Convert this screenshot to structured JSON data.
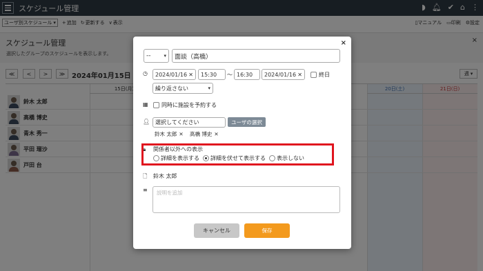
{
  "app": {
    "title": "スケジュール管理",
    "menu_icon": "hamburger-icon",
    "icons": [
      "bookmark-icon",
      "bell-icon",
      "check-icon",
      "home-icon",
      "more-vertical-icon"
    ]
  },
  "toolbar": {
    "view_select": "ユーザ別スケジュール",
    "add_label": "追加",
    "refresh_label": "更新する",
    "display_label": "表示",
    "manual_label": "マニュアル",
    "print_label": "印刷",
    "settings_label": "設定"
  },
  "page": {
    "title": "スケジュール管理",
    "description": "選択したグループのスケジュールを表示します。",
    "close": "×"
  },
  "nav": {
    "first": "≪",
    "prev": "<",
    "next": ">",
    "last": "≫",
    "date": "2024年01月15日",
    "view": "週"
  },
  "calendar": {
    "days": [
      "15日(月)",
      "20日(土)",
      "21日(日)"
    ],
    "users": [
      "鈴木 太郎",
      "高橋 博史",
      "青木 秀一",
      "平田 瑠沙",
      "戸田 台"
    ]
  },
  "modal": {
    "close": "×",
    "category": "--",
    "title_value": "面談（高橋）",
    "start_date": "2024/01/16",
    "start_time": "15:30",
    "tilde": "～",
    "end_time": "16:30",
    "end_date": "2024/01/16",
    "all_day": "終日",
    "repeat": "繰り返さない",
    "facility_check": "同時に施設を予約する",
    "user_placeholder": "選択してください",
    "user_select_button": "ユーザの選択",
    "selected_users": [
      "鈴木 太郎",
      "高橋 博史"
    ],
    "visibility_label": "関係者以外への表示",
    "visibility_options": [
      "詳細を表示する",
      "詳細を伏せて表示する",
      "表示しない"
    ],
    "visibility_selected": 1,
    "owner": "鈴木 太郎",
    "description_placeholder": "説明を追加",
    "cancel": "キャンセル",
    "save": "保存"
  },
  "colors": {
    "appbar": "#2f3a44",
    "save": "#f39a1e",
    "highlight": "#e0141e"
  }
}
